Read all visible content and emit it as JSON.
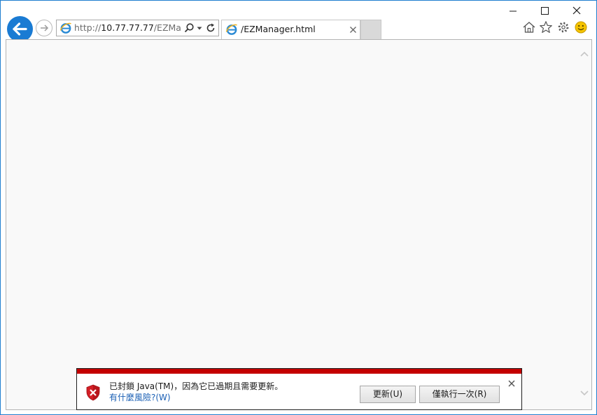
{
  "window": {
    "caption_buttons": [
      "minimize-icon",
      "maximize-icon",
      "close-icon"
    ]
  },
  "nav": {
    "back_icon": "arrow-left-icon",
    "forward_icon": "arrow-right-icon"
  },
  "address_bar": {
    "scheme": "http://",
    "host": "10.77.77.77",
    "path": "/EZMana",
    "icons": [
      "ie-icon",
      "search-icon",
      "chevron-down-icon",
      "refresh-icon"
    ]
  },
  "tabs": [
    {
      "title": "/EZManager.html",
      "active": true
    }
  ],
  "toolbar": {
    "icons": [
      "home-icon",
      "star-icon",
      "gear-icon",
      "smiley-icon"
    ]
  },
  "notification": {
    "message": "已封鎖 Java(TM)，因為它已過期且需要更新。",
    "link": "有什麼風險?(W)",
    "update_button": "更新(U)",
    "run_once_button": "僅執行一次(R)",
    "accent_color": "#c40000"
  }
}
